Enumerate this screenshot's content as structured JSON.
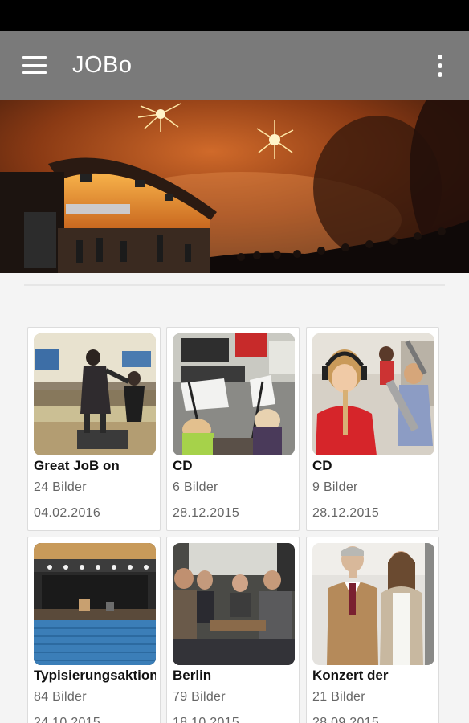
{
  "app_bar": {
    "title": "JOBo",
    "menu_icon": "hamburger-menu-icon",
    "overflow_icon": "more-vert-icon"
  },
  "hero": {
    "image": "fireworks-concert-stage-photo"
  },
  "albums": [
    {
      "title": "Great JoB on",
      "count": "24 Bilder",
      "date": "04.02.2016",
      "thumb": "dancers-on-stage"
    },
    {
      "title": "CD",
      "count": "6 Bilder",
      "date": "28.12.2015",
      "thumb": "recording-studio-music-stands"
    },
    {
      "title": "CD",
      "count": "9 Bilder",
      "date": "28.12.2015",
      "thumb": "girl-playing-recorder"
    },
    {
      "title": "Typisierungsaktion",
      "count": "84 Bilder",
      "date": "24.10.2015",
      "thumb": "concert-hall-blue-seats"
    },
    {
      "title": "Berlin",
      "count": "79 Bilder",
      "date": "18.10.2015",
      "thumb": "group-in-train"
    },
    {
      "title": "Konzert der",
      "count": "21 Bilder",
      "date": "28.09.2015",
      "thumb": "two-people-portrait"
    }
  ]
}
